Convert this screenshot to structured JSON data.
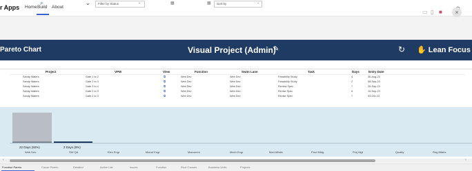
{
  "app": {
    "name": "r Apps",
    "nav": [
      "Home",
      "Build",
      "About"
    ]
  },
  "banner": {
    "left_label": "Pareto Chart",
    "title": "Visual Project (Admin)",
    "logo_text": "Lean Focus"
  },
  "filters": {
    "status_placeholder": "Filter by Status",
    "sort_placeholder": "Sort by"
  },
  "table": {
    "headers": [
      "Project",
      "VPW",
      "View",
      "Function",
      "Swim Lane",
      "Task",
      "Days",
      "Entry Date"
    ],
    "rows": [
      {
        "project": "Sandy Waters",
        "vpw": "Gate 1 to 2",
        "function": "Web Dev",
        "swim_lane": "Web Dev",
        "task": "Feasibility Study",
        "days": "4",
        "entry_date": "30-Aug-23"
      },
      {
        "project": "Sandy Waters",
        "vpw": "Gate 2 to 3",
        "function": "Web Dev",
        "swim_lane": "Web Dev",
        "task": "Feasibility Study",
        "days": "2",
        "entry_date": "08-Sep-23"
      },
      {
        "project": "Sandy Waters",
        "vpw": "Gate 3 to 4",
        "function": "Web Dev",
        "swim_lane": "Web Dev",
        "task": "Review Spec",
        "days": "7",
        "entry_date": "25-Sep-23"
      },
      {
        "project": "Sandy Waters",
        "vpw": "Gate 2 to 3",
        "function": "Web Dev",
        "swim_lane": "Web Dev",
        "task": "Revise Spec",
        "days": "8",
        "entry_date": "19-Sep-23"
      },
      {
        "project": "Sandy Waters",
        "vpw": "Gate 2 to 3",
        "function": "Web Dev",
        "swim_lane": "Web Dev",
        "task": "Revise Spec",
        "days": "7",
        "entry_date": "03-Oct-23"
      }
    ]
  },
  "pareto": {
    "bar_values_shown": [
      "22 Days (92%)",
      "2 Days (8%)"
    ],
    "categories": [
      "Web Dev",
      "SW QA",
      "Elec Engr",
      "Manuf Engr",
      "Marcomm",
      "Mech Engr",
      "Med Affairs",
      "Prod Mktg",
      "Proj Mgt",
      "Quality",
      "Reg Affairs"
    ],
    "bar_fractions": [
      0.92,
      0.08
    ]
  },
  "tabs": [
    "Function Pareto",
    "Cause Pareto",
    "Detailed",
    "Action List",
    "Issues",
    "Function",
    "Root Causes",
    "Business Units",
    "Projects"
  ],
  "colors": {
    "banner": "#1f3a63",
    "chart_bg": "#d9eaf3",
    "accent": "#3a5fcf",
    "bar_primary": "#b9bec6"
  }
}
